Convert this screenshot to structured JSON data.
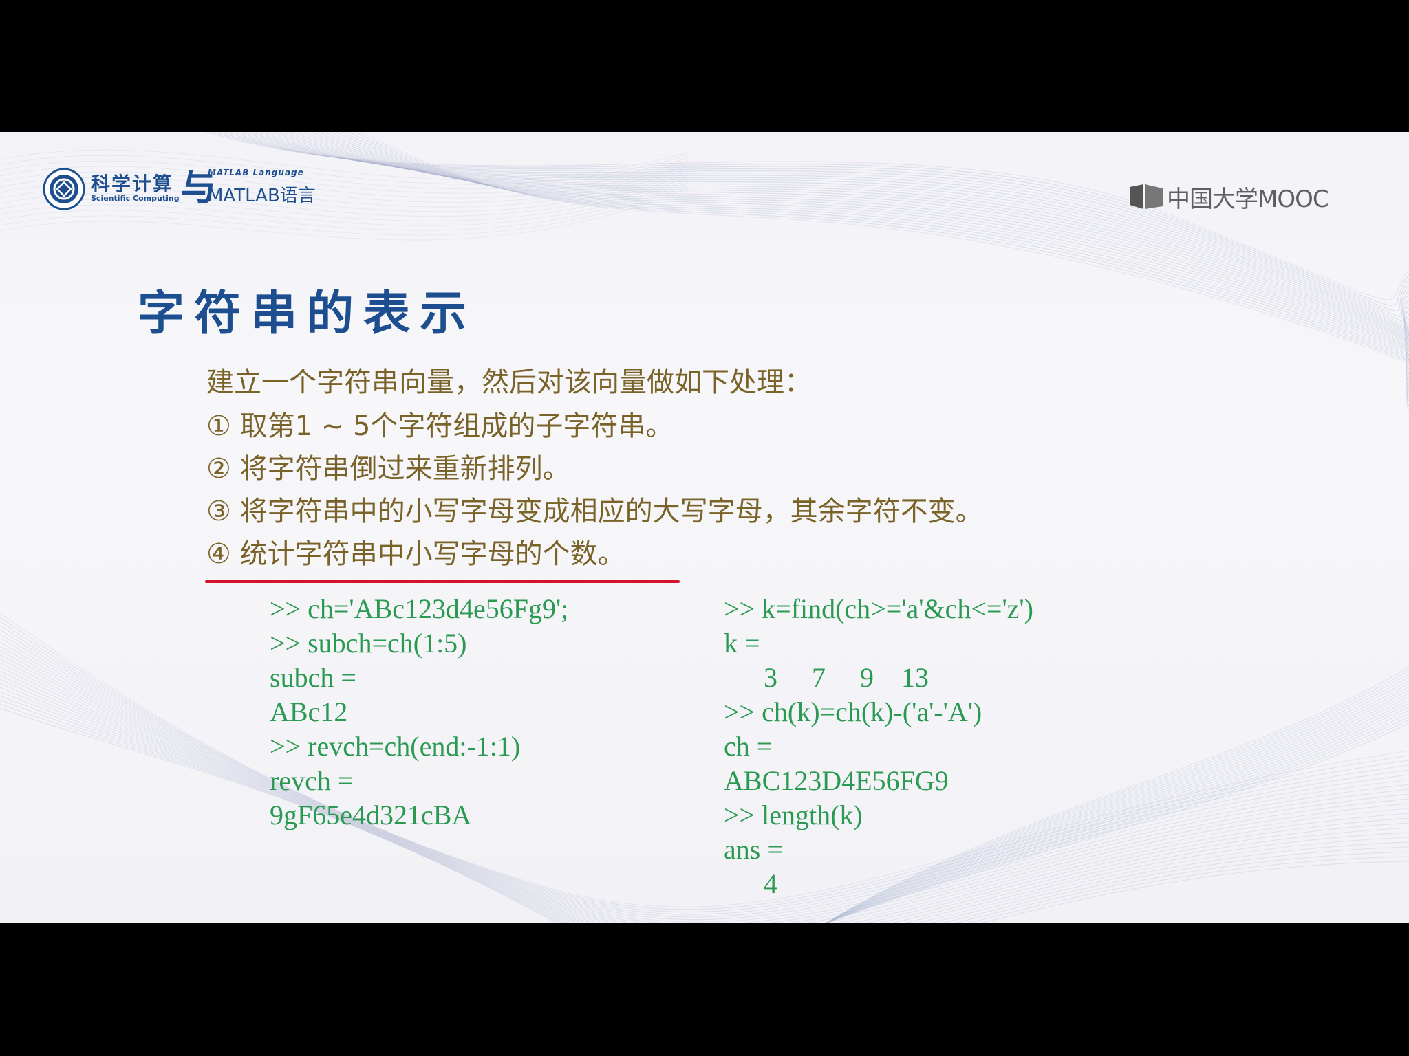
{
  "header": {
    "course_logo_cn": "科学计算",
    "course_logo_en": "Scientific Computing",
    "course_logo_yu": "与",
    "course_logo_lang": "MATLAB Language",
    "course_logo_matlab": "MATLAB语言",
    "platform_logo": "中国大学MOOC"
  },
  "slide": {
    "title": "字符串的表示",
    "intro": "建立一个字符串向量，然后对该向量做如下处理：",
    "steps": [
      "① 取第1 ~ 5个字符组成的子字符串。",
      "② 将字符串倒过来重新排列。",
      "③ 将字符串中的小写字母变成相应的大写字母，其余字符不变。",
      "④ 统计字符串中小写字母的个数。"
    ],
    "highlight_color": "#d3122b"
  },
  "code": {
    "left": [
      ">> ch='ABc123d4e56Fg9';",
      ">> subch=ch(1:5)",
      "subch =",
      "ABc12",
      ">> revch=ch(end:-1:1)",
      "revch =",
      "9gF65e4d321cBA"
    ],
    "right": [
      ">> k=find(ch>='a'&ch<='z')",
      "k =",
      "3     7     9    13",
      ">> ch(k)=ch(k)-('a'-'A')",
      "ch =",
      "ABC123D4E56FG9",
      ">> length(k)",
      "ans =",
      "4"
    ]
  },
  "colors": {
    "title": "#1d4f90",
    "task_text": "#7a6328",
    "code_text": "#2a9a52"
  }
}
